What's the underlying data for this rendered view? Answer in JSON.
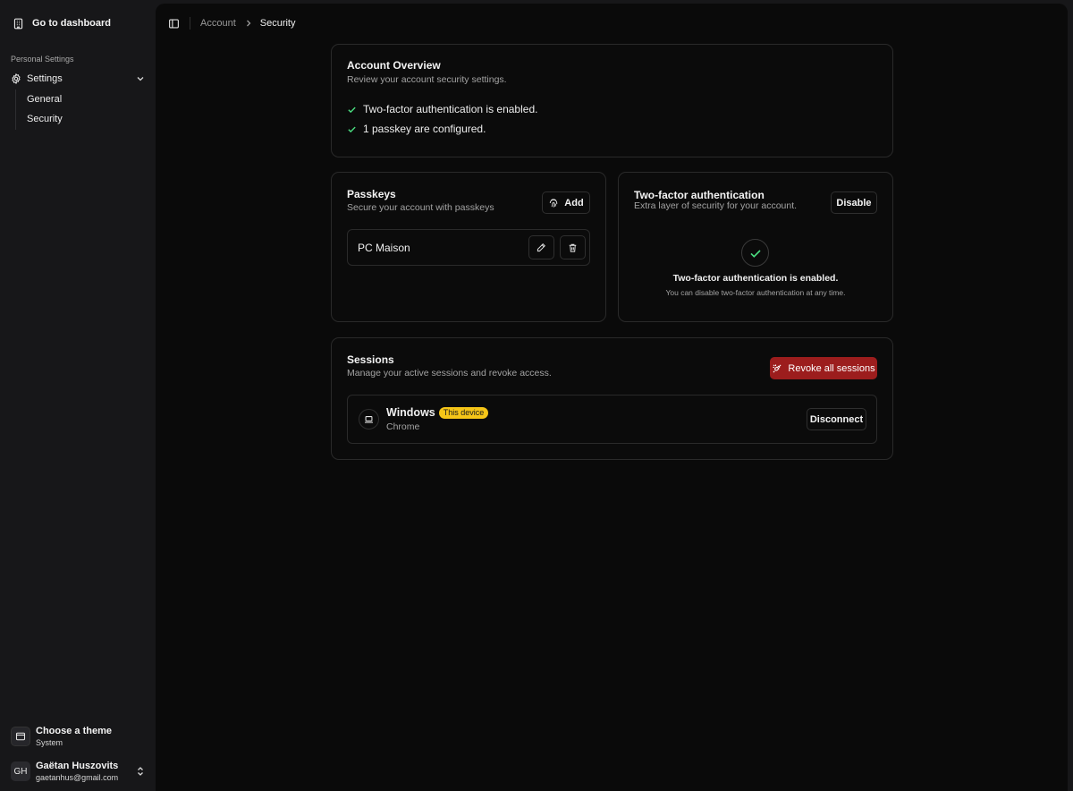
{
  "sidebar": {
    "dashboard_label": "Go to dashboard",
    "section_label": "Personal Settings",
    "settings_label": "Settings",
    "items": [
      {
        "label": "General"
      },
      {
        "label": "Security"
      }
    ],
    "theme": {
      "title": "Choose a theme",
      "value": "System"
    },
    "user": {
      "initials": "GH",
      "name": "Gaëtan Huszovits",
      "email": "gaetanhus@gmail.com"
    }
  },
  "breadcrumb": {
    "parent": "Account",
    "current": "Security"
  },
  "overview": {
    "title": "Account Overview",
    "description": "Review your account security settings.",
    "items": [
      "Two-factor authentication is enabled.",
      "1 passkey are configured."
    ]
  },
  "passkeys": {
    "title": "Passkeys",
    "description": "Secure your account with passkeys",
    "add_label": "Add",
    "list": [
      {
        "name": "PC Maison"
      }
    ]
  },
  "two_factor": {
    "title": "Two-factor authentication",
    "description": "Extra layer of security for your account.",
    "disable_label": "Disable",
    "status_title": "Two-factor authentication is enabled.",
    "status_note": "You can disable two-factor authentication at any time."
  },
  "sessions": {
    "title": "Sessions",
    "description": "Manage your active sessions and revoke access.",
    "revoke_label": "Revoke all sessions",
    "list": [
      {
        "os": "Windows",
        "badge": "This device",
        "browser": "Chrome",
        "action": "Disconnect"
      }
    ]
  },
  "colors": {
    "accent_success": "#4ade80",
    "danger": "#9c1d1d",
    "badge": "#f5c518"
  }
}
